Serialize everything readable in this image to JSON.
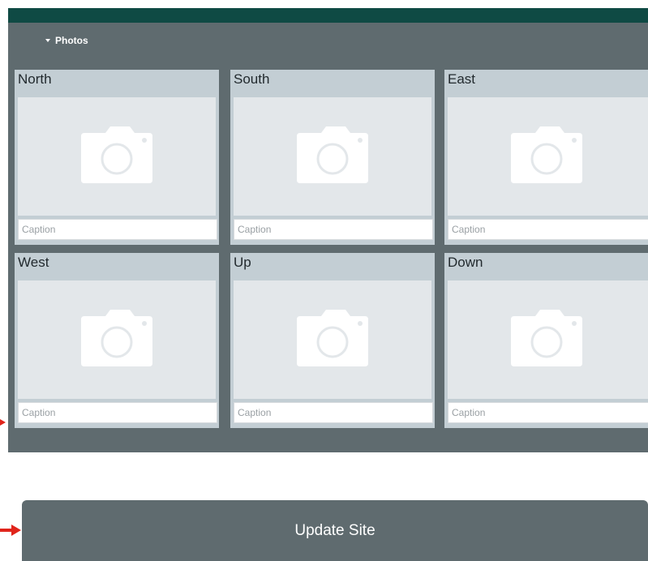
{
  "section": {
    "title": "Photos"
  },
  "photos": [
    {
      "label": "North",
      "caption_placeholder": "Caption"
    },
    {
      "label": "South",
      "caption_placeholder": "Caption"
    },
    {
      "label": "East",
      "caption_placeholder": "Caption"
    },
    {
      "label": "West",
      "caption_placeholder": "Caption"
    },
    {
      "label": "Up",
      "caption_placeholder": "Caption"
    },
    {
      "label": "Down",
      "caption_placeholder": "Caption"
    }
  ],
  "actions": {
    "update_label": "Update Site"
  },
  "colors": {
    "header": "#0f4a44",
    "panel": "#5f6b6f",
    "card": "#c3ced4",
    "annotation_arrow": "#e0241b"
  },
  "icons": {
    "photo_placeholder": "camera-icon",
    "section_toggle": "caret-down-icon",
    "annotation": "red-arrow-icon"
  }
}
